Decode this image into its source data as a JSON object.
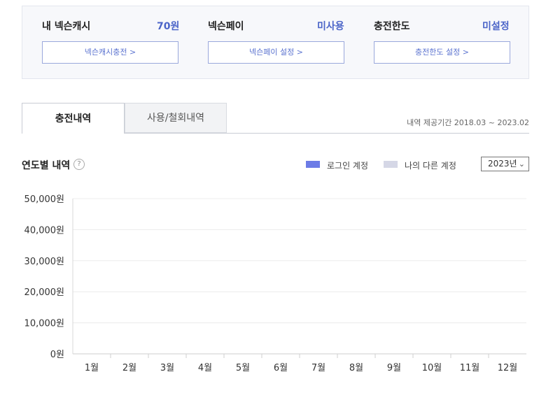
{
  "summary": {
    "cash": {
      "title": "내 넥슨캐시",
      "value": "70원",
      "button": "넥슨캐시충전 >"
    },
    "pay": {
      "title": "넥슨페이",
      "value": "미사용",
      "button": "넥슨페이 설정 >"
    },
    "limit": {
      "title": "충전한도",
      "value": "미설정",
      "button": "충전한도 설정 >"
    }
  },
  "tabs": {
    "active": "충전내역",
    "inactive": "사용/철회내역"
  },
  "period_text": "내역 제공기간 2018.03 ~ 2023.02",
  "yearly": {
    "title": "연도별 내역",
    "legend": [
      {
        "label": "로그인 계정",
        "color": "#6c7be6"
      },
      {
        "label": "나의 다른 계정",
        "color": "#d5d7e6"
      }
    ],
    "year_selected": "2023년"
  },
  "chart_data": {
    "type": "bar",
    "categories": [
      "1월",
      "2월",
      "3월",
      "4월",
      "5월",
      "6월",
      "7월",
      "8월",
      "9월",
      "10월",
      "11월",
      "12월"
    ],
    "series": [
      {
        "name": "로그인 계정",
        "values": [
          0,
          0,
          0,
          0,
          0,
          0,
          0,
          0,
          0,
          0,
          0,
          0
        ]
      },
      {
        "name": "나의 다른 계정",
        "values": [
          0,
          0,
          0,
          0,
          0,
          0,
          0,
          0,
          0,
          0,
          0,
          0
        ]
      }
    ],
    "yticks": [
      "0원",
      "10,000원",
      "20,000원",
      "30,000원",
      "40,000원",
      "50,000원"
    ],
    "ylim": [
      0,
      50000
    ],
    "grid": true
  }
}
